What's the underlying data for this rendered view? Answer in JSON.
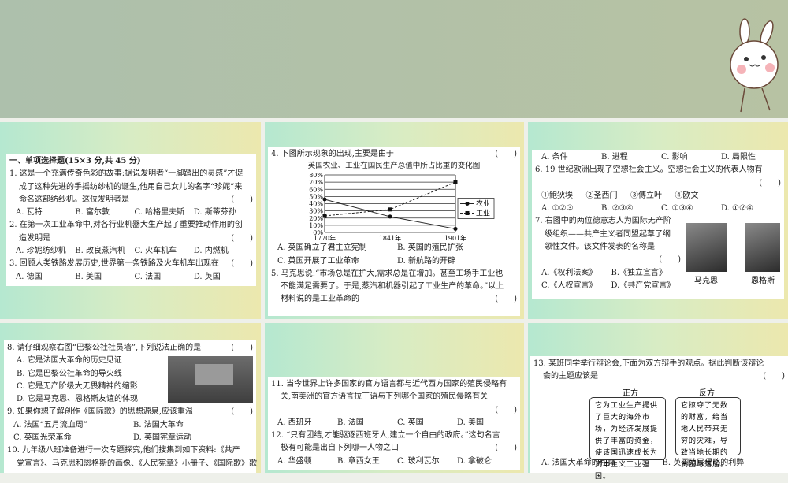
{
  "section_title": "一、单项选择题(15×3 分,共 45 分)",
  "paren": "(　　)",
  "q1": {
    "text": "1. 这是一个充满传奇色彩的故事:据说发明者“一脚踏出的灵感”才促",
    "cont1": "成了这种先进的手摇纺纱机的诞生,他用自己女儿的名字“珍妮”来",
    "cont2": "命名这部纺纱机。这位发明者是",
    "options": [
      "A. 瓦特",
      "B. 富尔敦",
      "C. 哈格里夫斯",
      "D. 斯蒂芬孙"
    ]
  },
  "q2": {
    "text": "2. 在第一次工业革命中,对各行业机器大生产起了重要推动作用的创",
    "cont1": "造发明是",
    "options": [
      "A. 珍妮纺纱机",
      "B. 改良蒸汽机",
      "C. 火车机车",
      "D. 内燃机"
    ]
  },
  "q3": {
    "text": "3. 回顾人类铁路发展历史,世界第一条铁路及火车机车出现在",
    "options": [
      "A. 德国",
      "B. 美国",
      "C. 法国",
      "D. 英国"
    ]
  },
  "q4": {
    "text": "4. 下图所示现象的出现,主要是由于",
    "options": [
      "A. 英国确立了君主立宪制",
      "B. 英国的殖民扩张",
      "C. 英国开展了工业革命",
      "D. 新航路的开辟"
    ]
  },
  "chart_data": {
    "type": "line",
    "title": "英国农业、工业在国民生产总值中所占比重的变化图",
    "categories": [
      "1770年",
      "1841年",
      "1901年"
    ],
    "yticks": [
      "0%",
      "10%",
      "20%",
      "30%",
      "40%",
      "50%",
      "60%",
      "70%",
      "80%"
    ],
    "ylim": [
      0,
      80
    ],
    "series": [
      {
        "name": "农业",
        "values": [
          46,
          22,
          5
        ],
        "style": "solid-circle"
      },
      {
        "name": "工业",
        "values": [
          23,
          32,
          70
        ],
        "style": "dashed-square"
      }
    ],
    "legend": "right"
  },
  "q5": {
    "text": "5. 马克思说:“市场总是在扩大,需求总是在增加。甚至工场手工业也",
    "cont1": "不能满足需要了。于是,蒸汽和机器引起了工业生产的革命。”以上",
    "cont2": "材料说的是工业革命的",
    "options": [
      "A. 条件",
      "B. 进程",
      "C. 影响",
      "D. 局限性"
    ]
  },
  "q6": {
    "text": "6. 19 世纪欧洲出现了空想社会主义。空想社会主义的代表人物有",
    "items": [
      "①鲍狄埃",
      "②圣西门",
      "③傅立叶",
      "④欧文"
    ],
    "options": [
      "A. ①②③",
      "B. ②③④",
      "C. ①③④",
      "D. ①②④"
    ]
  },
  "q7": {
    "text": "7. 右图中的两位德意志人为国际无产阶",
    "cont1": "级组织——共产主义者同盟起草了纲",
    "cont2": "领性文件。该文件发表的名称是",
    "captions": [
      "马克思",
      "恩格斯"
    ],
    "options": [
      "A.《权利法案》",
      "B.《独立宣言》",
      "C.《人权宣言》",
      "D.《共产党宣言》"
    ]
  },
  "q8": {
    "text": "8. 请仔细观察右图“巴黎公社社员墙”,下列说法正确的是",
    "options": [
      "A. 它是法国大革命的历史见证",
      "B. 它是巴黎公社革命的导火线",
      "C. 它是无产阶级大无畏精神的缩影",
      "D. 它是马克思、恩格斯友谊的体现"
    ]
  },
  "q9": {
    "text": "9. 如果你想了解创作《国际歌》的思想源泉,应该重温",
    "options": [
      "A. 法国“五月流血周”",
      "B. 法国大革命",
      "C. 英国光荣革命",
      "D. 英国宪章运动"
    ]
  },
  "q10": {
    "text": "10. 九年级八班准备进行一次专题探究,他们搜集到如下资料:《共产",
    "cont1": "党宣言》、马克思和恩格斯的画像、《人民宪章》小册子、《国际歌》歌"
  },
  "q11": {
    "text": "11. 当今世界上许多国家的官方语言都与近代西方国家的殖民侵略有",
    "cont1": "关,南美洲的官方语言拉丁语与下列哪个国家的殖民侵略有关",
    "options": [
      "A. 西班牙",
      "B. 法国",
      "C. 英国",
      "D. 美国"
    ]
  },
  "q12": {
    "text": "12. “只有团结,才能驱逐西班牙人,建立一个自由的政府。”这句名言",
    "cont1": "极有可能是出自下列哪一人物之口",
    "options": [
      "A. 华盛顿",
      "B. 章西女王",
      "C. 玻利瓦尔",
      "D. 拿破仑"
    ]
  },
  "q13": {
    "text": "13. 某班同学举行辩论会,下面为双方辩手的观点。据此判断该辩论",
    "cont1": "会的主题应该是",
    "pro_label": "正方",
    "con_label": "反方",
    "pro": "它为工业生产提供了巨大的海外市场，为经济发展提供了丰富的资金，使该国迅速成长为资本主义工业强国。",
    "con": "它掠夺了无数的财富，给当地人民带来无穷的灾难，导致当地长期的贫困与落后。",
    "options": [
      "A. 法国大革命的利弊",
      "B. 英国殖民侵略的利弊"
    ]
  }
}
